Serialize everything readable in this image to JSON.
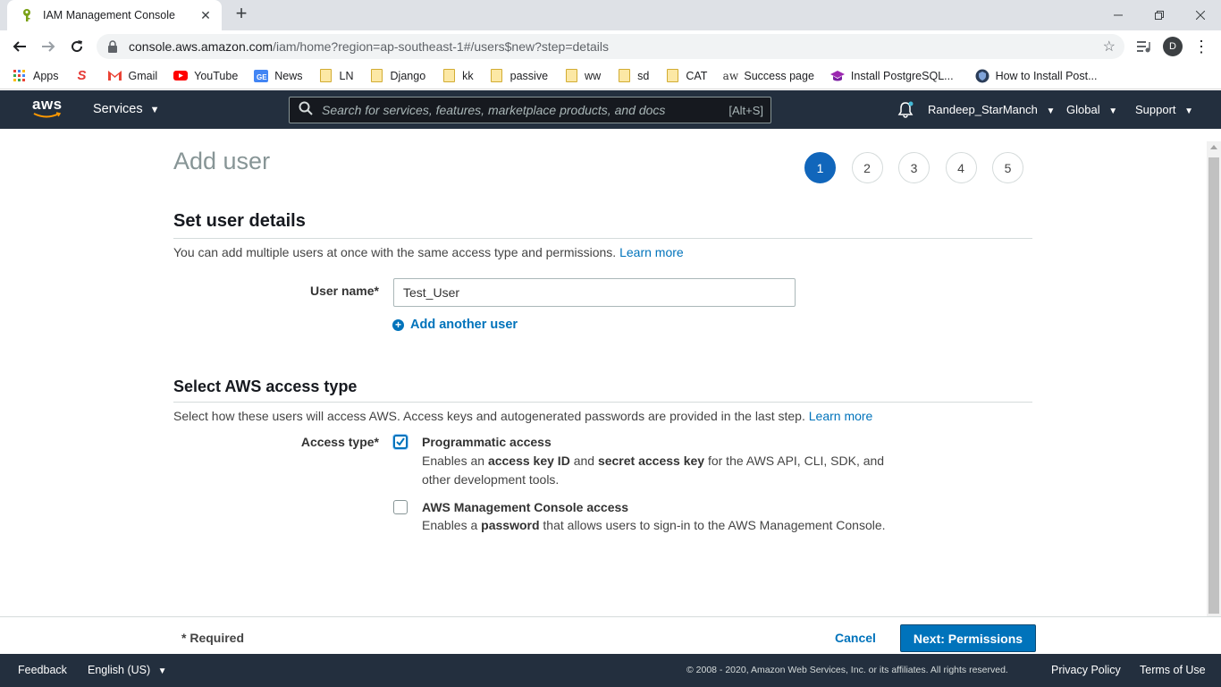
{
  "browser": {
    "tab_title": "IAM Management Console",
    "tab_close": "✕",
    "new_tab": "+",
    "url_host": "console.aws.amazon.com",
    "url_path": "/iam/home?region=ap-southeast-1#/users$new?step=details",
    "profile_initial": "D",
    "bookmarks": [
      {
        "label": "Apps",
        "icon": "apps-grid-icon"
      },
      {
        "label": "",
        "icon": "s-logo-icon"
      },
      {
        "label": "Gmail",
        "icon": "gmail-icon"
      },
      {
        "label": "YouTube",
        "icon": "youtube-icon"
      },
      {
        "label": "News",
        "icon": "google-news-icon"
      },
      {
        "label": "LN",
        "icon": "folder-icon"
      },
      {
        "label": "Django",
        "icon": "folder-icon"
      },
      {
        "label": "kk",
        "icon": "folder-icon"
      },
      {
        "label": "passive",
        "icon": "folder-icon"
      },
      {
        "label": "ww",
        "icon": "folder-icon"
      },
      {
        "label": "sd",
        "icon": "folder-icon"
      },
      {
        "label": "CAT",
        "icon": "folder-icon"
      },
      {
        "label": "Success page",
        "icon": "aw-logo-icon"
      },
      {
        "label": "Install PostgreSQL...",
        "icon": "graduation-cap-icon"
      },
      {
        "label": "How to Install Post...",
        "icon": "shield-logo-icon"
      }
    ]
  },
  "aws_nav": {
    "logo_text": "aws",
    "services": "Services",
    "search_placeholder": "Search for services, features, marketplace products, and docs",
    "search_shortcut": "[Alt+S]",
    "account": "Randeep_StarManch",
    "region": "Global",
    "support": "Support"
  },
  "page": {
    "title": "Add user",
    "steps": [
      "1",
      "2",
      "3",
      "4",
      "5"
    ],
    "active_step": "1"
  },
  "set_user_details": {
    "heading": "Set user details",
    "description": "You can add multiple users at once with the same access type and permissions.",
    "learn_more": "Learn more",
    "user_name_label": "User name*",
    "user_name_value": "Test_User",
    "add_another_user": "Add another user"
  },
  "access_type": {
    "heading": "Select AWS access type",
    "description": "Select how these users will access AWS. Access keys and autogenerated passwords are provided in the last step.",
    "learn_more": "Learn more",
    "label": "Access type*",
    "programmatic": {
      "title": "Programmatic access",
      "desc_1": "Enables an ",
      "desc_b1": "access key ID",
      "desc_2": " and ",
      "desc_b2": "secret access key",
      "desc_3": " for the AWS API, CLI, SDK, and other development tools.",
      "checked": true
    },
    "console": {
      "title": "AWS Management Console access",
      "desc_1": "Enables a ",
      "desc_b1": "password",
      "desc_2": " that allows users to sign-in to the AWS Management Console.",
      "checked": false
    }
  },
  "actions": {
    "required": "* Required",
    "cancel": "Cancel",
    "next": "Next: Permissions"
  },
  "footer": {
    "feedback": "Feedback",
    "language": "English (US)",
    "copyright": "© 2008 - 2020, Amazon Web Services, Inc. or its affiliates. All rights reserved.",
    "privacy": "Privacy Policy",
    "terms": "Terms of Use"
  },
  "colors": {
    "aws_nav": "#232f3e",
    "link": "#0073bb",
    "primary_button": "#0073bb",
    "active_step": "#1166bb"
  }
}
